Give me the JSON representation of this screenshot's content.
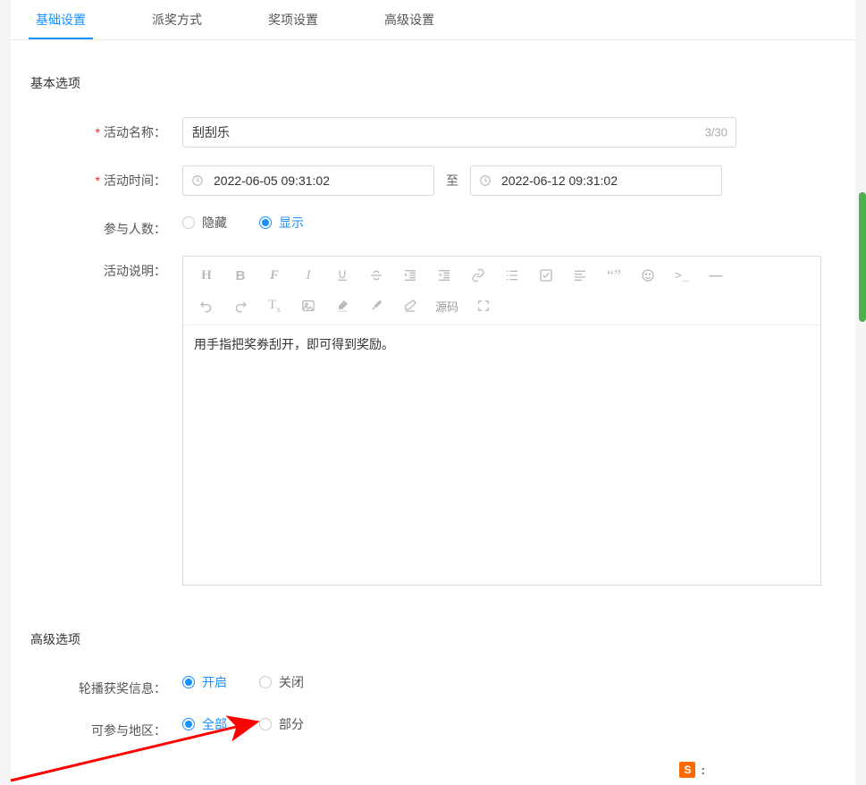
{
  "tabs": [
    {
      "label": "基础设置",
      "active": true
    },
    {
      "label": "派奖方式",
      "active": false
    },
    {
      "label": "奖项设置",
      "active": false
    },
    {
      "label": "高级设置",
      "active": false
    }
  ],
  "sections": {
    "basic_title": "基本选项",
    "advanced_title": "高级选项"
  },
  "form": {
    "activity_name": {
      "label": "活动名称：",
      "value": "刮刮乐",
      "count": "3/30"
    },
    "activity_time": {
      "label": "活动时间：",
      "start": "2022-06-05 09:31:02",
      "to": "至",
      "end": "2022-06-12 09:31:02"
    },
    "participants": {
      "label": "参与人数：",
      "option_hide": "隐藏",
      "option_show": "显示"
    },
    "description": {
      "label": "活动说明：",
      "content": "用手指把奖券刮开，即可得到奖励。",
      "source_btn": "源码"
    },
    "broadcast": {
      "label": "轮播获奖信息：",
      "option_on": "开启",
      "option_off": "关闭"
    },
    "region": {
      "label": "可参与地区：",
      "option_all": "全部",
      "option_partial": "部分"
    }
  },
  "ime": {
    "symbol": "S",
    "mode": ":"
  }
}
